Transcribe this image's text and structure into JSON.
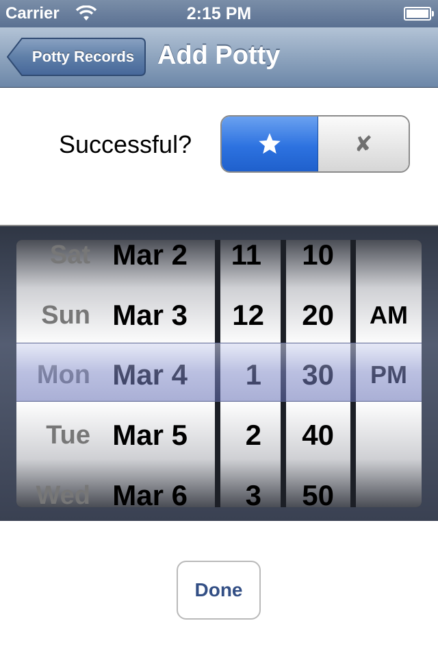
{
  "status_bar": {
    "carrier": "Carrier",
    "time": "2:15 PM"
  },
  "nav": {
    "back_label": "Potty Records",
    "title": "Add Potty"
  },
  "form": {
    "successful_label": "Successful?",
    "segments": [
      {
        "icon": "star-icon",
        "selected": true
      },
      {
        "icon": "close-icon",
        "glyph": "✘",
        "selected": false
      }
    ]
  },
  "picker": {
    "dates": [
      {
        "dow": "Sat",
        "md": "Mar 2"
      },
      {
        "dow": "Sun",
        "md": "Mar 3"
      },
      {
        "dow": "Mon",
        "md": "Mar 4"
      },
      {
        "dow": "Tue",
        "md": "Mar 5"
      },
      {
        "dow": "Wed",
        "md": "Mar 6"
      }
    ],
    "hours": [
      "11",
      "12",
      "1",
      "2",
      "3"
    ],
    "minutes": [
      "10",
      "20",
      "30",
      "40",
      "50"
    ],
    "ampm": [
      "AM",
      "PM"
    ],
    "selected": {
      "date": "Mon Mar 4",
      "hour": "1",
      "minute": "30",
      "ampm": "PM"
    }
  },
  "done_label": "Done",
  "colors": {
    "accent": "#2d72e0",
    "nav": "#6c87a8",
    "done_text": "#334f85"
  }
}
